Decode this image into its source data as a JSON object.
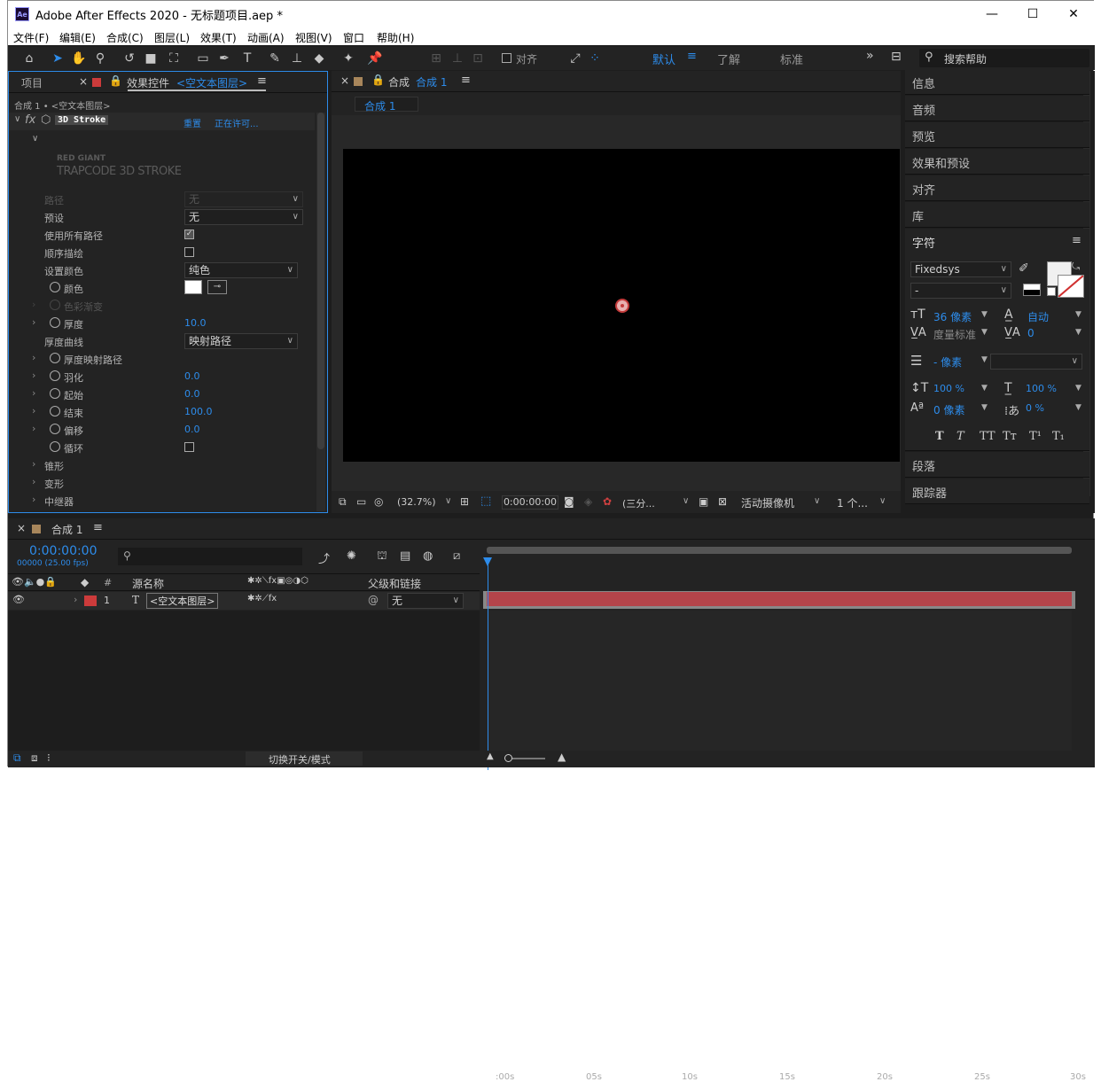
{
  "window": {
    "title": "Adobe After Effects 2020 - 无标题项目.aep *",
    "app_icon": "Ae",
    "minimize": "—",
    "maximize": "☐",
    "close": "✕"
  },
  "menu": [
    "文件(F)",
    "编辑(E)",
    "合成(C)",
    "图层(L)",
    "效果(T)",
    "动画(A)",
    "视图(V)",
    "窗口",
    "帮助(H)"
  ],
  "toolbar": {
    "align_label": "对齐",
    "workspaces": [
      "默认",
      "了解",
      "标准"
    ],
    "search_placeholder": "搜索帮助"
  },
  "left_panel": {
    "tab_project": "项目",
    "tab_effects": "效果控件",
    "tab_effects_layer": "<空文本图层>",
    "breadcrumb": "合成 1 • <空文本图层>",
    "effect_name": "3D Stroke",
    "reset": "重置",
    "license": "正在许可...",
    "brand_line1": "RED GIANT",
    "brand_line2": "TRAPCODE 3D STROKE",
    "params": [
      {
        "label": "路径",
        "value": "无",
        "kind": "dropdown-disabled"
      },
      {
        "label": "预设",
        "value": "无",
        "kind": "dropdown"
      },
      {
        "label": "使用所有路径",
        "value": "checked",
        "kind": "checkbox"
      },
      {
        "label": "顺序描绘",
        "value": "",
        "kind": "checkbox"
      },
      {
        "label": "设置颜色",
        "value": "纯色",
        "kind": "dropdown"
      },
      {
        "label": "颜色",
        "value": "#ffffff",
        "kind": "color"
      },
      {
        "label": "色彩渐变",
        "value": "",
        "kind": "group-disabled"
      },
      {
        "label": "厚度",
        "value": "10.0",
        "kind": "number"
      },
      {
        "label": "厚度曲线",
        "value": "映射路径",
        "kind": "dropdown"
      },
      {
        "label": "厚度映射路径",
        "value": "",
        "kind": "group"
      },
      {
        "label": "羽化",
        "value": "0.0",
        "kind": "number"
      },
      {
        "label": "起始",
        "value": "0.0",
        "kind": "number"
      },
      {
        "label": "结束",
        "value": "100.0",
        "kind": "number"
      },
      {
        "label": "偏移",
        "value": "0.0",
        "kind": "number"
      },
      {
        "label": "循环",
        "value": "",
        "kind": "checkbox"
      },
      {
        "label": "锥形",
        "value": "",
        "kind": "group"
      },
      {
        "label": "变形",
        "value": "",
        "kind": "group"
      },
      {
        "label": "中继器",
        "value": "",
        "kind": "group"
      }
    ]
  },
  "composition": {
    "tab": "合成",
    "tab_name": "合成 1",
    "sub_tab": "合成 1",
    "zoom": "(32.7%)",
    "timecode": "0:00:00:00",
    "resolution": "(三分...",
    "camera": "活动摄像机",
    "views": "1 个..."
  },
  "right_panel": {
    "items": [
      "信息",
      "音频",
      "预览",
      "效果和预设",
      "对齐",
      "库",
      "字符",
      "段落",
      "跟踪器"
    ],
    "font_family": "Fixedsys",
    "font_style": "-",
    "font_size": "36 像素",
    "leading": "自动",
    "kerning": "度量标准",
    "tracking": "0",
    "stroke_width": "- 像素",
    "vert_scale": "100 %",
    "horiz_scale": "100 %",
    "baseline": "0 像素",
    "tsume": "0 %",
    "style_buttons": [
      "T",
      "T",
      "TT",
      "Tт",
      "T¹",
      "T₁"
    ]
  },
  "timeline": {
    "tab": "合成 1",
    "timecode": "0:00:00:00",
    "fps": "00000 (25.00 fps)",
    "col_num": "#",
    "col_source": "源名称",
    "col_parent": "父级和链接",
    "layer": {
      "num": "1",
      "type": "T",
      "name": "<空文本图层>",
      "parent": "无"
    },
    "ticks": [
      ":00s",
      "05s",
      "10s",
      "15s",
      "20s",
      "25s",
      "30s"
    ],
    "toggle_label": "切换开关/模式",
    "layer_color": "#cc3b3b",
    "bar_color": "#b4444a"
  },
  "colors": {
    "accent": "#2d8ceb",
    "panel": "#232323",
    "bg": "#1d1d1d"
  }
}
